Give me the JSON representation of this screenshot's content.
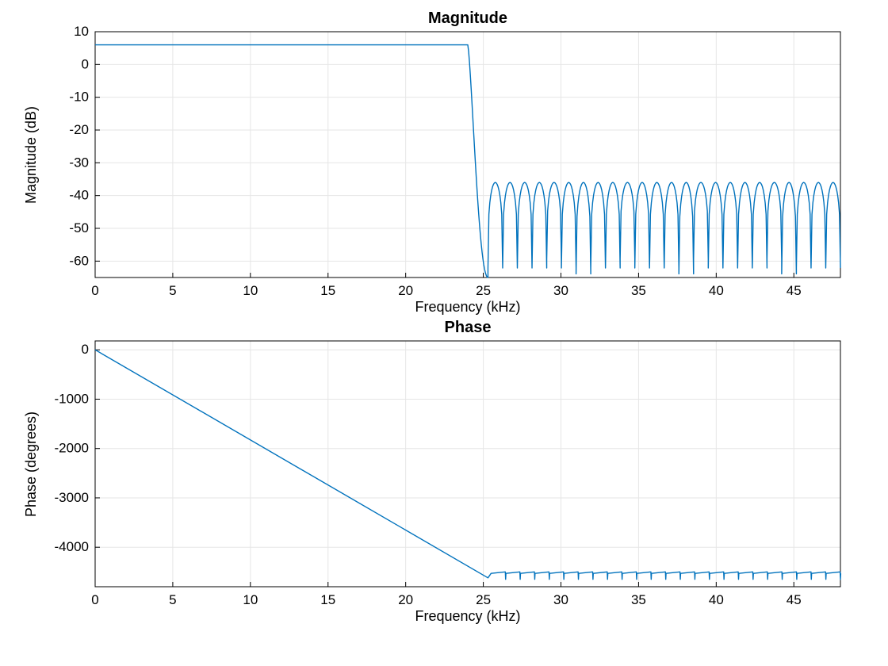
{
  "chart_data": [
    {
      "type": "line",
      "title": "Magnitude",
      "xlabel": "Frequency (kHz)",
      "ylabel": "Magnitude (dB)",
      "xlim": [
        0,
        48
      ],
      "ylim": [
        -65,
        10
      ],
      "xticks": [
        0,
        5,
        10,
        15,
        20,
        25,
        30,
        35,
        40,
        45
      ],
      "yticks": [
        -60,
        -50,
        -40,
        -30,
        -20,
        -10,
        0,
        10
      ],
      "line_color": "#0072BD",
      "filter": {
        "passband_db": 6,
        "lobe_peak_db": -36,
        "notch_db": -65,
        "cutoff_khz": 25,
        "stopband_lobes": 24
      }
    },
    {
      "type": "line",
      "title": "Phase",
      "xlabel": "Frequency (kHz)",
      "ylabel": "Phase (degrees)",
      "xlim": [
        0,
        48
      ],
      "ylim": [
        -4800,
        180
      ],
      "xticks": [
        0,
        5,
        10,
        15,
        20,
        25,
        30,
        35,
        40,
        45
      ],
      "yticks": [
        -4000,
        -3000,
        -2000,
        -1000,
        0
      ],
      "line_color": "#0072BD",
      "phase": {
        "start_deg": 0,
        "knee_khz": 25.3,
        "knee_deg": -4620,
        "plateau_deg": -4530,
        "sawtooth_drop_deg": 150,
        "sawtooth_count": 24
      }
    }
  ]
}
